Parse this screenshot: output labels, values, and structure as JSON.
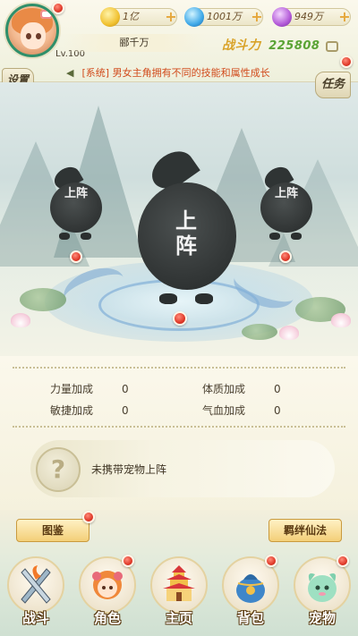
{
  "header": {
    "level": "Lv.100",
    "player_name": "郦千万",
    "gold": "1亿",
    "diamond": "1001万",
    "energy": "949万",
    "power_label": "战斗力",
    "power_value": "225808",
    "settings_label": "设置",
    "task_label": "任务"
  },
  "notice": {
    "tag": "[系统]",
    "message": "男女主角拥有不同的技能和属性成长"
  },
  "formation": {
    "left_slot": "上阵",
    "center_slot": "上阵",
    "right_slot": "上阵"
  },
  "attributes": [
    {
      "label": "力量加成",
      "value": "0"
    },
    {
      "label": "体质加成",
      "value": "0"
    },
    {
      "label": "敏捷加成",
      "value": "0"
    },
    {
      "label": "气血加成",
      "value": "0"
    }
  ],
  "pet": {
    "icon_text": "?",
    "status": "未携带宠物上阵"
  },
  "buttons": {
    "codex": "图鉴",
    "bond": "羁绊仙法"
  },
  "nav": [
    {
      "label": "战斗",
      "icon": "battle-icon"
    },
    {
      "label": "角色",
      "icon": "character-icon"
    },
    {
      "label": "主页",
      "icon": "home-icon"
    },
    {
      "label": "背包",
      "icon": "bag-icon"
    },
    {
      "label": "宠物",
      "icon": "pet-icon"
    }
  ],
  "colors": {
    "accent_gold": "#f5c033",
    "power_green": "#5aa334",
    "notice_red": "#d14b1c",
    "badge_red": "#e03a2a"
  }
}
